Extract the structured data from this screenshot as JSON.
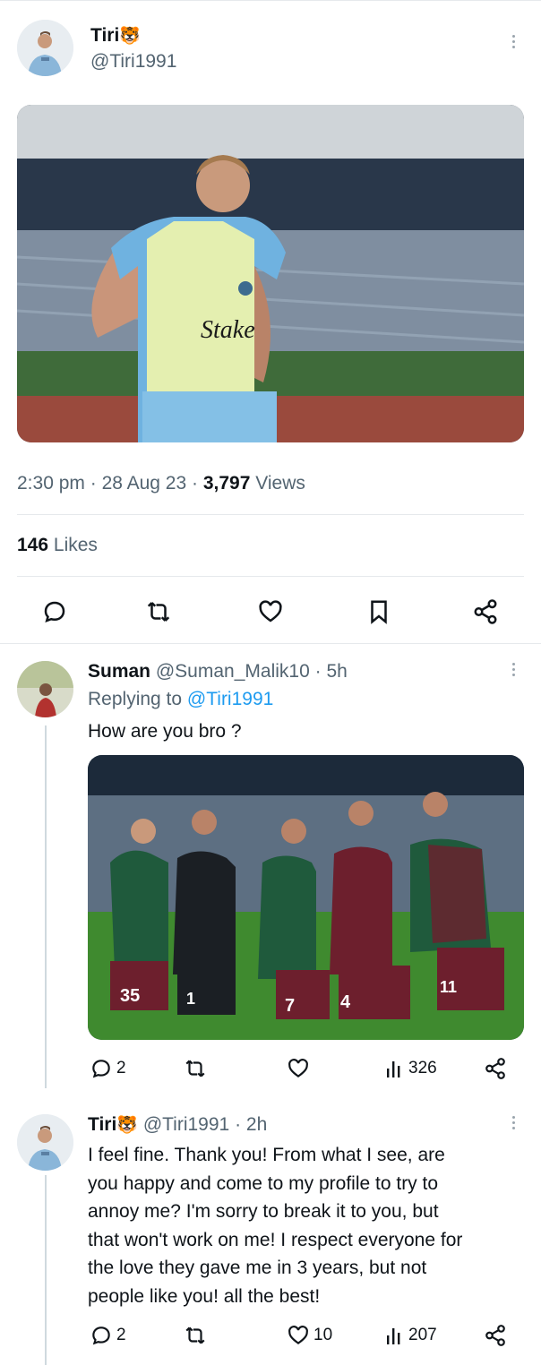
{
  "main_tweet": {
    "author_name": "Tiri",
    "author_emoji": "🐯",
    "author_handle": "@Tiri1991",
    "time": "2:30 pm",
    "date": "28 Aug 23",
    "views_count": "3,797",
    "views_label": "Views",
    "likes_count": "146",
    "likes_label": "Likes",
    "photo_sponsor_text": "Stake"
  },
  "reply_1": {
    "author_name": "Suman",
    "author_handle": "@Suman_Malik10",
    "age": "5h",
    "replying_label": "Replying to",
    "replying_handle": "@Tiri1991",
    "text": "How are you bro ?",
    "replies": "2",
    "views": "326",
    "jersey_numbers": [
      "35",
      "1",
      "7",
      "4",
      "11"
    ]
  },
  "reply_2": {
    "author_name": "Tiri",
    "author_emoji": "🐯",
    "author_handle": "@Tiri1991",
    "age": "2h",
    "text_lines": [
      "I feel fine. Thank you! From what I see, are",
      "you happy and come to my profile to try to",
      "annoy me? I'm sorry to break it to you, but",
      "that won't work on me! I respect everyone for",
      "the love they gave me in 3 years, but not",
      "people like you! all the best!"
    ],
    "replies": "2",
    "likes": "10",
    "views": "207"
  },
  "separator": " · ",
  "colors": {
    "text": "#0f1419",
    "secondary": "#536471",
    "link": "#1d9bf0",
    "divider": "#e6e9ec"
  }
}
